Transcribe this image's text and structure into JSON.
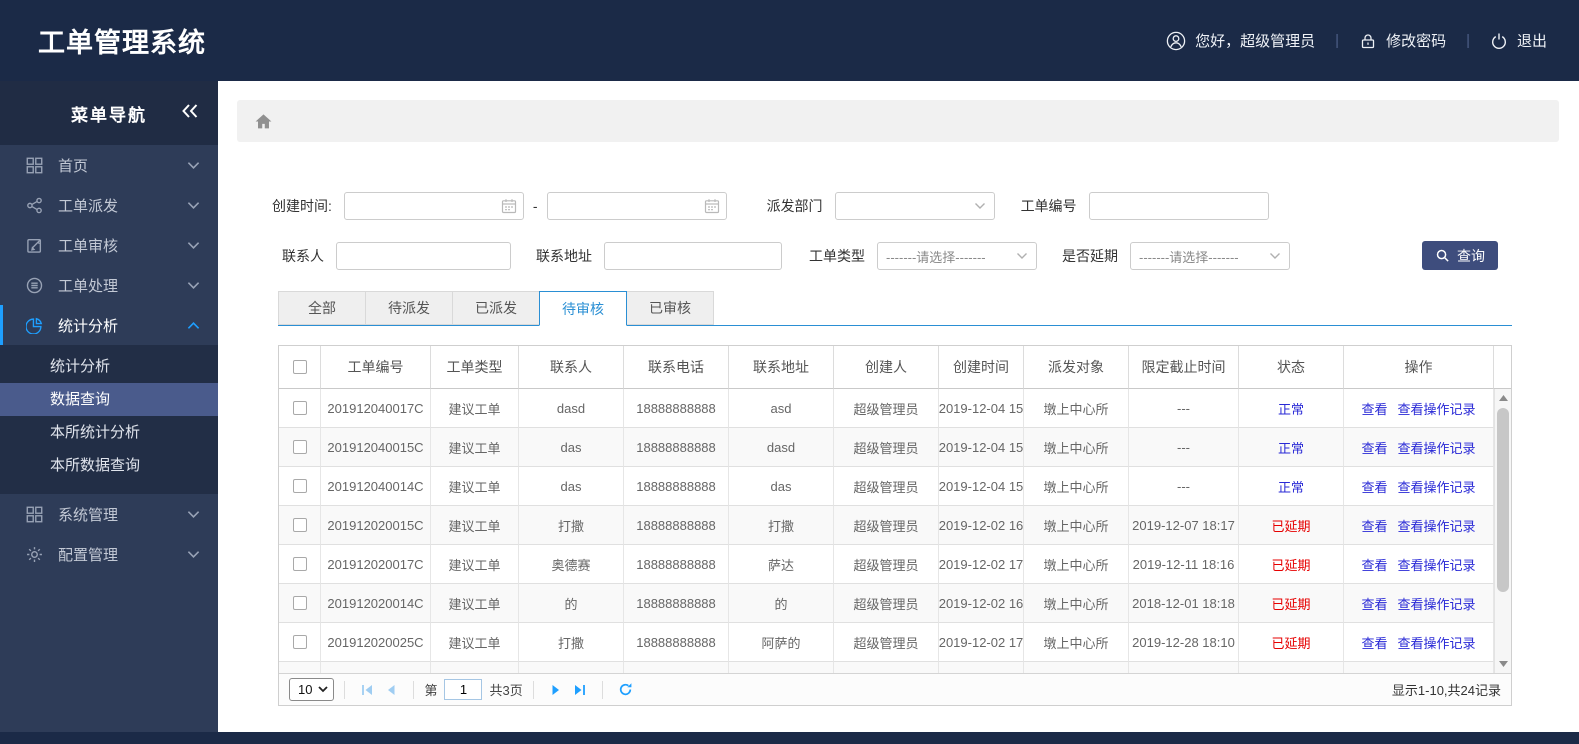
{
  "app": {
    "title": "工单管理系统"
  },
  "topbar": {
    "greeting": "您好，超级管理员",
    "change_password": "修改密码",
    "logout": "退出",
    "separator": "|"
  },
  "sidebar": {
    "title": "菜单导航",
    "collapse_icon": "double-chevron-left-icon",
    "items": [
      {
        "name": "home",
        "label": "首页",
        "icon": "grid-icon",
        "expanded": false
      },
      {
        "name": "dispatch",
        "label": "工单派发",
        "icon": "share-icon",
        "expanded": false
      },
      {
        "name": "review",
        "label": "工单审核",
        "icon": "edit-icon",
        "expanded": false
      },
      {
        "name": "process",
        "label": "工单处理",
        "icon": "stack-icon",
        "expanded": false
      },
      {
        "name": "stats",
        "label": "统计分析",
        "icon": "pie-chart-icon",
        "expanded": true,
        "children": [
          {
            "name": "stats-analysis",
            "label": "统计分析",
            "active": false
          },
          {
            "name": "data-query",
            "label": "数据查询",
            "active": true
          },
          {
            "name": "local-stats-analysis",
            "label": "本所统计分析",
            "active": false
          },
          {
            "name": "local-data-query",
            "label": "本所数据查询",
            "active": false
          }
        ]
      },
      {
        "name": "system",
        "label": "系统管理",
        "icon": "grid-icon",
        "expanded": false
      },
      {
        "name": "config",
        "label": "配置管理",
        "icon": "gear-icon",
        "expanded": false
      }
    ]
  },
  "filters": {
    "create_time": {
      "label": "创建时间:",
      "from_value": "",
      "to_value": "",
      "separator": "-"
    },
    "dispatch_dept": {
      "label": "派发部门",
      "value": ""
    },
    "order_no": {
      "label": "工单编号",
      "value": ""
    },
    "contact": {
      "label": "联系人",
      "value": ""
    },
    "contact_address": {
      "label": "联系地址",
      "value": ""
    },
    "order_type": {
      "label": "工单类型",
      "value": "-------请选择-------"
    },
    "is_delayed": {
      "label": "是否延期",
      "value": "-------请选择-------"
    },
    "search_button": "查询"
  },
  "tabs": {
    "active": "待审核",
    "items": [
      "全部",
      "待派发",
      "已派发",
      "待审核",
      "已审核"
    ]
  },
  "table": {
    "headers": [
      "工单编号",
      "工单类型",
      "联系人",
      "联系电话",
      "联系地址",
      "创建人",
      "创建时间",
      "派发对象",
      "限定截止时间",
      "状态",
      "操作"
    ],
    "actions": [
      "查看",
      "查看操作记录"
    ],
    "colors": {
      "link": "#2929d6",
      "status_normal": "#2929d6",
      "status_delayed": "#e60000"
    },
    "rows": [
      {
        "order_no": "201912040017C",
        "order_type": "建议工单",
        "contact": "dasd",
        "phone": "18888888888",
        "address": "asd",
        "creator": "超级管理员",
        "created": "2019-12-04 15",
        "dispatch_to": "墩上中心所",
        "deadline": "---",
        "status": "正常"
      },
      {
        "order_no": "201912040015C",
        "order_type": "建议工单",
        "contact": "das",
        "phone": "18888888888",
        "address": "dasd",
        "creator": "超级管理员",
        "created": "2019-12-04 15",
        "dispatch_to": "墩上中心所",
        "deadline": "---",
        "status": "正常"
      },
      {
        "order_no": "201912040014C",
        "order_type": "建议工单",
        "contact": "das",
        "phone": "18888888888",
        "address": "das",
        "creator": "超级管理员",
        "created": "2019-12-04 15",
        "dispatch_to": "墩上中心所",
        "deadline": "---",
        "status": "正常"
      },
      {
        "order_no": "201912020015C",
        "order_type": "建议工单",
        "contact": "打撒",
        "phone": "18888888888",
        "address": "打撒",
        "creator": "超级管理员",
        "created": "2019-12-02 16",
        "dispatch_to": "墩上中心所",
        "deadline": "2019-12-07 18:17",
        "status": "已延期"
      },
      {
        "order_no": "201912020017C",
        "order_type": "建议工单",
        "contact": "奥德赛",
        "phone": "18888888888",
        "address": "萨达",
        "creator": "超级管理员",
        "created": "2019-12-02 17",
        "dispatch_to": "墩上中心所",
        "deadline": "2019-12-11 18:16",
        "status": "已延期"
      },
      {
        "order_no": "201912020014C",
        "order_type": "建议工单",
        "contact": "的",
        "phone": "18888888888",
        "address": "的",
        "creator": "超级管理员",
        "created": "2019-12-02 16",
        "dispatch_to": "墩上中心所",
        "deadline": "2018-12-01 18:18",
        "status": "已延期"
      },
      {
        "order_no": "201912020025C",
        "order_type": "建议工单",
        "contact": "打撒",
        "phone": "18888888888",
        "address": "阿萨的",
        "creator": "超级管理员",
        "created": "2019-12-02 17",
        "dispatch_to": "墩上中心所",
        "deadline": "2019-12-28 18:10",
        "status": "已延期"
      }
    ]
  },
  "pagination": {
    "page_size": "10",
    "page_prefix": "第",
    "current_page": "1",
    "total_pages": "共3页",
    "summary": "显示1-10,共24记录"
  }
}
